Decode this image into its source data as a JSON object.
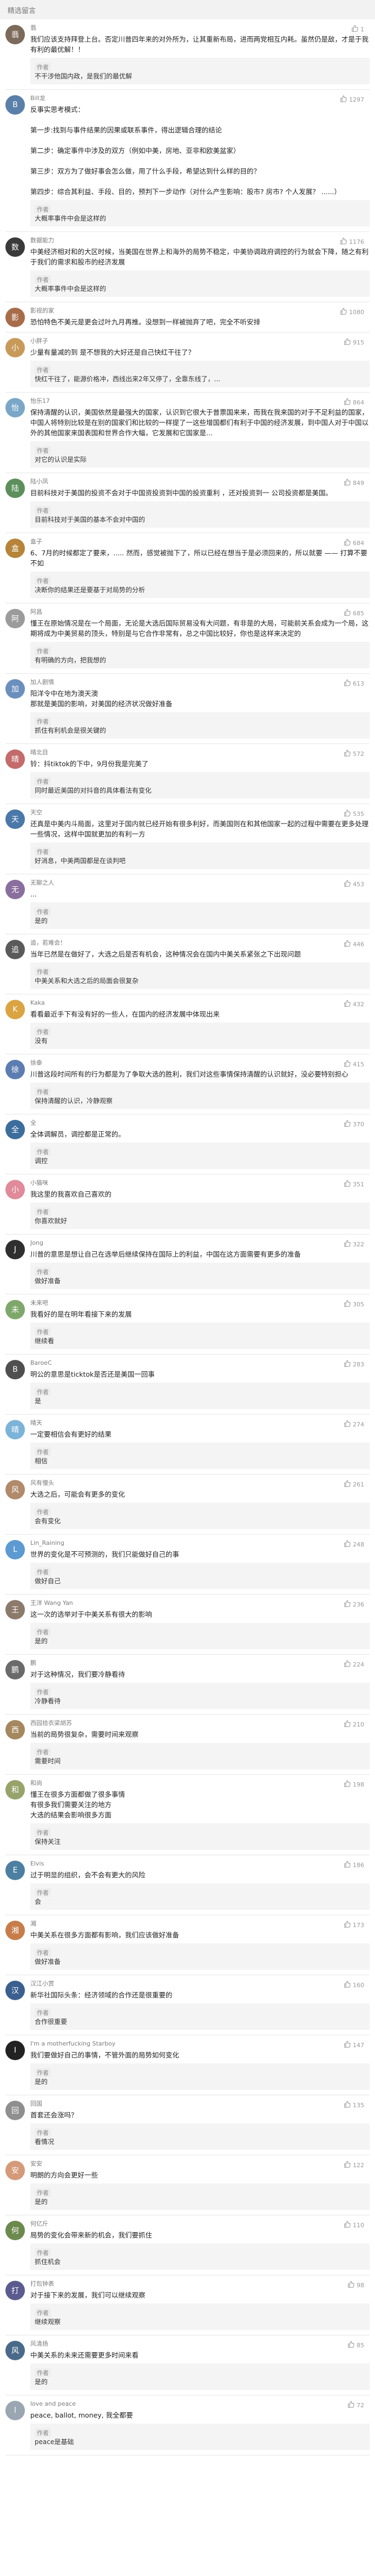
{
  "header": {
    "title": "精选留言"
  },
  "comments": [
    {
      "name": "翡",
      "avatar_color": "#7c6a5a",
      "likes": "1",
      "text": "我们应该支持拜登上台。否定川普四年来的对外所为，让其重新布局，进而两党相互内耗。虽然仍是敌，才是于我有利的最优解！！",
      "reply": {
        "author": "作者",
        "text": "不干涉他国内政，是我们的最优解"
      }
    },
    {
      "name": "Bill龙",
      "avatar_color": "#5a7fa8",
      "likes": "1297",
      "text": "反事实思考模式：\n\n第一步:找到与事件结果的因果或联系事件，得出逻辑合理的结论\n\n第二步：确定事件中涉及的双方（例如中美，房地、亚非和欧美盆家）\n\n第三步：双方为了做好事会怎么做，用了什么手段，希望达到什么样的目的？\n\n第四步：综合其利益、手段、目的，预判下一步动作（对什么产生影响：股市? 房市? 个人发展？ ......）",
      "reply": {
        "author": "作者",
        "text": "大概率事件中会是这样的"
      }
    },
    {
      "name": "数据能力",
      "avatar_color": "#3a3a3a",
      "likes": "1176",
      "text": "中美经济相对和的大区时候，当美国在世界上和海外的局势不稳定，中美协调政府调控的行为就会下降，随之有利于我们的需求和股市的经济发展",
      "reply": {
        "author": "作者",
        "text": "大概率事件中会是这样的"
      }
    },
    {
      "name": "影视的家",
      "avatar_color": "#a86c4a",
      "likes": "1080",
      "text": "恐怕特色不美元是更会过叶九月再推。没想到一样被抛弃了吧，完全不听安排"
    },
    {
      "name": "小胖子",
      "avatar_color": "#c89a5a",
      "likes": "915",
      "text": "少量有量减的到 是不想我的大好还是自己快红干往了？",
      "reply": {
        "author": "作者",
        "text": "快红干往了，能源价格冲，西线出来2年又停了，全靠东线了，..."
      }
    },
    {
      "name": "怡乐17",
      "avatar_color": "#7aa7c7",
      "likes": "864",
      "text": "保持清醒的认识，美国依然是最强大的国家，认识到它很大于普票国来来，而我在我来国的对于不足利益的国家，中国人将特别比较是在别的国家们和比较的一样提了一这些增国都们有利于中国的经济发展，到中国人对于中国以外的其他国家来国表国和世界合作大幅，它发展和它国家是...",
      "reply": {
        "author": "作者",
        "text": "对它的认识是实际"
      }
    },
    {
      "name": "陆小凤",
      "avatar_color": "#5d8f5d",
      "likes": "849",
      "text": "目前科技对于美国的投资不会对于中国资投资到中国的投资重利 ，还对投资到一 公司投资都是美国。",
      "reply": {
        "author": "作者",
        "text": "目前科技对于美国的基本不会对中国的"
      }
    },
    {
      "name": "盒子",
      "avatar_color": "#b6853a",
      "likes": "684",
      "text": "6、7月的时候都定了要来，..... 然而，感觉被抛下了，所以已经在想当于是必须回来的，所以就要 —— 打算不要不如",
      "reply": {
        "author": "作者",
        "text": "决断你的结果还是要基于对局势的分析"
      }
    },
    {
      "name": "阿昌",
      "avatar_color": "#9b9b9b",
      "likes": "685",
      "text": "懂王在原始情况是在一个局面，无论是大选后国际贸易没有大问题，有非是的大局，可能前关系会成为一个局，这期将成为中美贸易的顶头，特别是与它合作非常有，总之中国比较好，你也是这样来决定的",
      "reply": {
        "author": "作者",
        "text": "有明确的方向，把我想的"
      }
    },
    {
      "name": "加人剧情",
      "avatar_color": "#6b8fbd",
      "likes": "613",
      "text": "阳洋令中在地为澳天澳\n那就是美国的影响，对美国的经济状况做好准备",
      "reply": {
        "author": "作者",
        "text": "抓住有利机会是很关键的"
      }
    },
    {
      "name": "晴北目",
      "avatar_color": "#c46b6b",
      "likes": "572",
      "text": "铃：抖tiktok的下中，9月份我是完美了",
      "reply": {
        "author": "作者",
        "text": "同时最近美国的对抖音的具体看法有变化"
      }
    },
    {
      "name": "天空",
      "avatar_color": "#4a78a8",
      "likes": "535",
      "text": "还真是中美内斗局面，这里对于国内就已经开始有很多利好，而美国则在和其他国家一起的过程中需要在更多处理一些情况，这样中国就更加的有利一方",
      "reply": {
        "author": "作者",
        "text": "好消息，中美两国都是在谈判吧"
      }
    },
    {
      "name": "无聊之人",
      "avatar_color": "#8a6f9e",
      "likes": "453",
      "text": "...",
      "reply": {
        "author": "作者",
        "text": "是的"
      }
    },
    {
      "name": "追，若难会！",
      "avatar_color": "#5a5a5a",
      "likes": "446",
      "text": "当年已然是在做好了，大选之后是否有机会，这种情况会在国内中美关系紧张之下出现问题",
      "reply": {
        "author": "作者",
        "text": "中美关系和大选之后的局面会很复杂"
      }
    },
    {
      "name": "Kaka",
      "avatar_color": "#d9a441",
      "likes": "432",
      "text": "看看最近手下有没有好的一些人，在国内的经济发展中体现出来",
      "reply": {
        "author": "作者",
        "text": "没有"
      }
    },
    {
      "name": "徐泰",
      "avatar_color": "#5b7db1",
      "likes": "415",
      "text": "川普这段时间所有的行为都是为了争取大选的胜利，我们对这些事情保持清醒的认识就好，没必要特别担心",
      "reply": {
        "author": "作者",
        "text": "保持清醒的认识，冷静观察"
      }
    },
    {
      "name": "全",
      "avatar_color": "#3d6d9c",
      "likes": "370",
      "text": "全体调解员，调控都是正常的。",
      "reply": {
        "author": "作者",
        "text": "调控"
      }
    },
    {
      "name": "小猫咪",
      "avatar_color": "#e08a9a",
      "likes": "351",
      "text": "我这里的我喜欢自己喜欢的",
      "reply": {
        "author": "作者",
        "text": "你喜欢就好"
      }
    },
    {
      "name": "Jong",
      "avatar_color": "#2f2f2f",
      "likes": "322",
      "text": "川普的意思是想让自己在选举后继续保持在国际上的利益，中国在这方面需要有更多的准备",
      "reply": {
        "author": "作者",
        "text": "做好准备"
      }
    },
    {
      "name": "未来吧",
      "avatar_color": "#7ea86b",
      "likes": "305",
      "text": "我看好的是在明年看接下来的发展",
      "reply": {
        "author": "作者",
        "text": "继续看"
      }
    },
    {
      "name": "BaroeC",
      "avatar_color": "#4f4f4f",
      "likes": "283",
      "text": "明公的意思是ticktok是否还是美国一回事",
      "reply": {
        "author": "作者",
        "text": "是"
      }
    },
    {
      "name": "晴天",
      "avatar_color": "#7cb3d9",
      "likes": "274",
      "text": "一定要相信会有更好的结果",
      "reply": {
        "author": "作者",
        "text": "相信"
      }
    },
    {
      "name": "风有慢头",
      "avatar_color": "#b08a6a",
      "likes": "261",
      "text": "大选之后，可能会有更多的变化",
      "reply": {
        "author": "作者",
        "text": "会有变化"
      }
    },
    {
      "name": "Lin_Raining",
      "avatar_color": "#5c9ad1",
      "likes": "248",
      "text": "世界的变化是不可预测的，我们只能做好自己的事",
      "reply": {
        "author": "作者",
        "text": "做好自己"
      }
    },
    {
      "name": "王洋 Wang Yan",
      "avatar_color": "#8c7a6a",
      "likes": "236",
      "text": "这一次的选举对于中美关系有很大的影响",
      "reply": {
        "author": "作者",
        "text": "是的"
      }
    },
    {
      "name": "鹏",
      "avatar_color": "#6a6a6a",
      "likes": "224",
      "text": "对于这种情况，我们要冷静看待",
      "reply": {
        "author": "作者",
        "text": "冷静看待"
      }
    },
    {
      "name": "西园拾衣梁胡苏",
      "avatar_color": "#a5885f",
      "likes": "210",
      "text": "当前的局势很复杂，需要时间来观察",
      "reply": {
        "author": "作者",
        "text": "需要时间"
      }
    },
    {
      "name": "和尚",
      "avatar_color": "#97a36b",
      "likes": "198",
      "text": "懂王在很多方面都做了很多事情\n有很多我们需要关注的地方\n大选的结果会影响很多方面",
      "reply": {
        "author": "作者",
        "text": "保持关注"
      }
    },
    {
      "name": "Elvis",
      "avatar_color": "#4d7fa1",
      "likes": "186",
      "text": "过于明显的组织，会不会有更大的风险",
      "reply": {
        "author": "作者",
        "text": "会"
      }
    },
    {
      "name": "湘",
      "avatar_color": "#c77d4a",
      "likes": "173",
      "text": "中美关系在很多方面都有影响，我们应该做好准备",
      "reply": {
        "author": "作者",
        "text": "做好准备"
      }
    },
    {
      "name": "汉江小赏",
      "avatar_color": "#3b5f8f",
      "likes": "160",
      "text": "新华社国际头条：经济领域的合作还是很重要的",
      "reply": {
        "author": "作者",
        "text": "合作很重要"
      }
    },
    {
      "name": "I'm a motherfucking Starboy",
      "avatar_color": "#222222",
      "likes": "147",
      "text": "我们要做好自己的事情，不管外面的局势如何变化",
      "reply": {
        "author": "作者",
        "text": "是的"
      }
    },
    {
      "name": "回国",
      "avatar_color": "#8f8f8f",
      "likes": "135",
      "text": "首套还会涨吗？",
      "reply": {
        "author": "作者",
        "text": "看情况"
      }
    },
    {
      "name": "安安",
      "avatar_color": "#d49a7a",
      "likes": "122",
      "text": "明朗的方向会更好一些",
      "reply": {
        "author": "作者",
        "text": "是的"
      }
    },
    {
      "name": "何亿斤",
      "avatar_color": "#6c8a4e",
      "likes": "110",
      "text": "局势的变化会带来新的机会，我们要抓住",
      "reply": {
        "author": "作者",
        "text": "抓住机会"
      }
    },
    {
      "name": "打包钟表",
      "avatar_color": "#5b5b8f",
      "likes": "98",
      "text": "对于接下来的发展，我们可以继续观察",
      "reply": {
        "author": "作者",
        "text": "继续观察"
      }
    },
    {
      "name": "风清扬",
      "avatar_color": "#4a6a8a",
      "likes": "85",
      "text": "中美关系的未来还需要更多时间来看",
      "reply": {
        "author": "作者",
        "text": "是的"
      }
    },
    {
      "name": "love and peace",
      "avatar_color": "#9aa6b2",
      "likes": "72",
      "text": "peace, ballot, money, 我全都要",
      "reply": {
        "author": "作者",
        "text": "peace是基础"
      }
    }
  ],
  "icons": {
    "like": "thumbs-up-icon"
  }
}
